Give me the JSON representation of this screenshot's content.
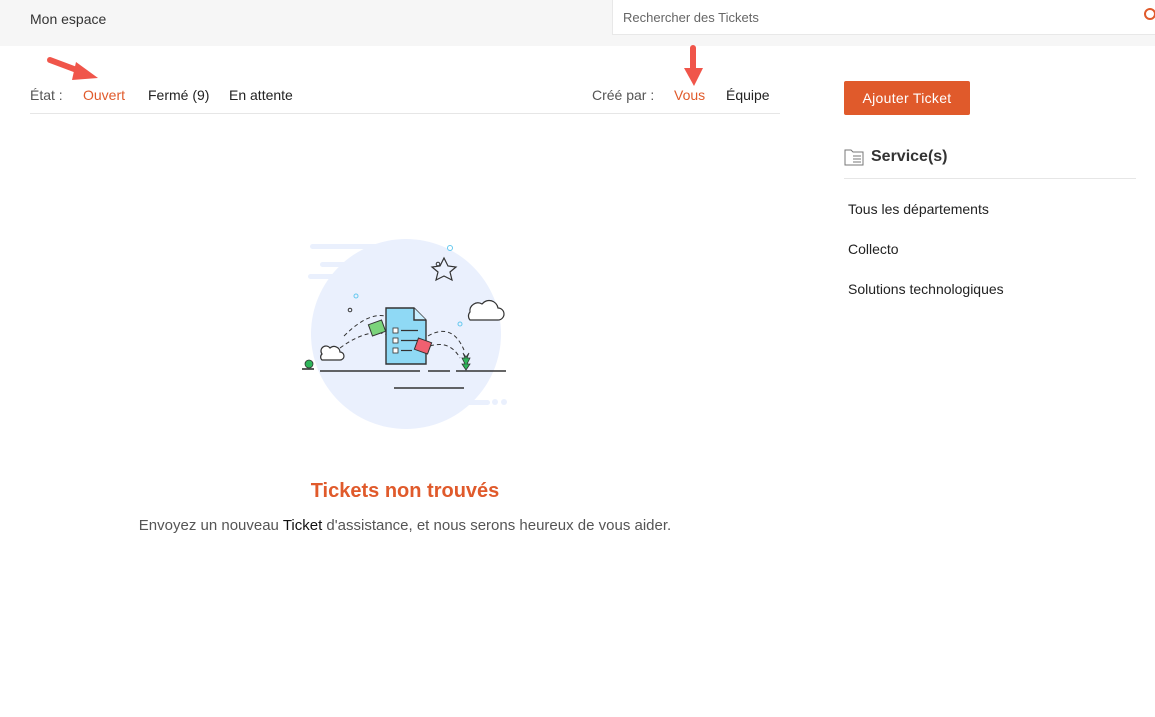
{
  "header": {
    "breadcrumb": "Mon espace",
    "search_placeholder": "Rechercher des Tickets"
  },
  "filters": {
    "state_label": "État :",
    "state_options": [
      "Ouvert",
      "Fermé (9)",
      "En attente"
    ],
    "state_selected": "Ouvert",
    "created_by_label": "Créé par :",
    "created_by_options": [
      "Vous",
      "Équipe"
    ],
    "created_by_selected": "Vous"
  },
  "sidebar": {
    "add_button": "Ajouter Ticket",
    "services_title": "Service(s)",
    "departments": [
      "Tous les départements",
      "Collecto",
      "Solutions technologiques"
    ],
    "selected_department": "Tous les départements"
  },
  "empty_state": {
    "title": "Tickets non trouvés",
    "message_before": "Envoyez un nouveau ",
    "message_highlight": "Ticket",
    "message_after": " d'assistance, et nous serons heureux de vous aider."
  },
  "colors": {
    "accent": "#e05a2b",
    "annotation_arrow": "#f0554a"
  }
}
